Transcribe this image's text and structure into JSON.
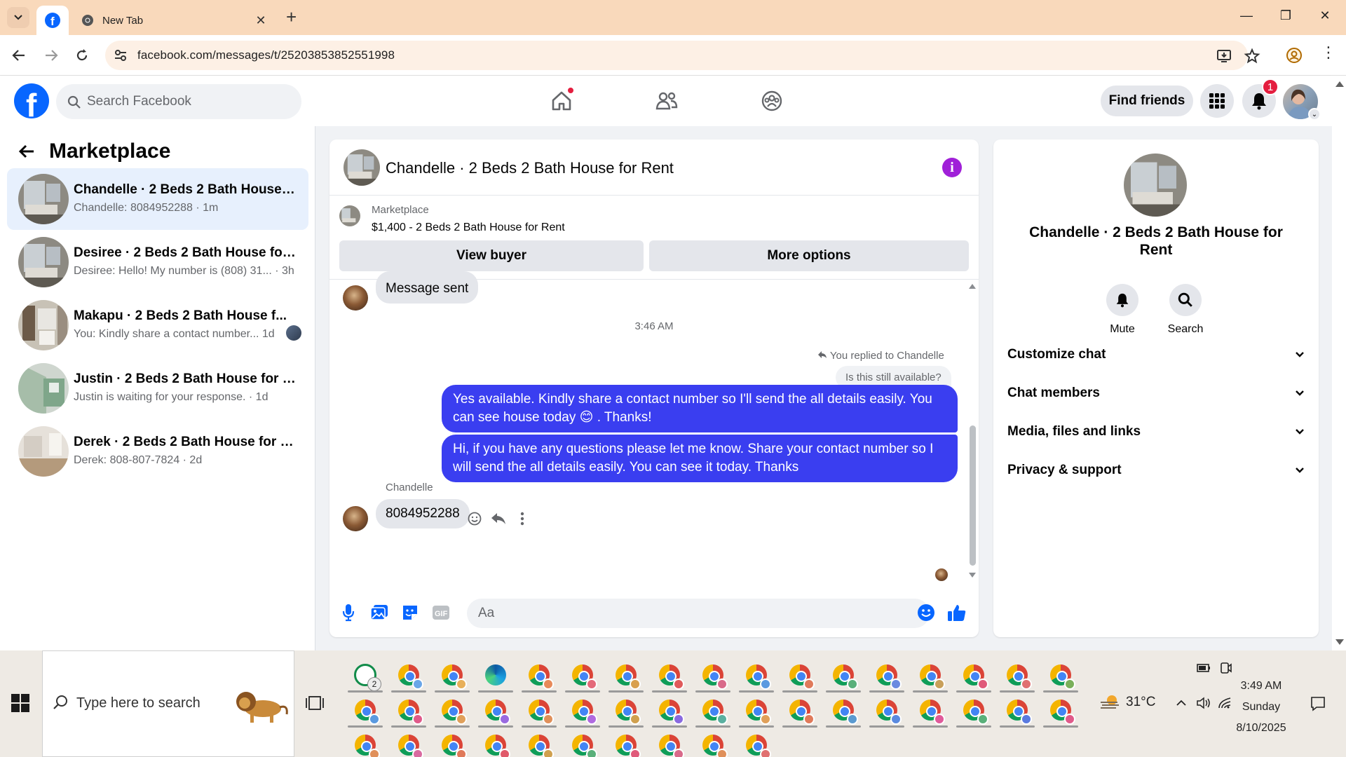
{
  "browser": {
    "tabs": [
      {
        "title": "",
        "icon": "facebook-icon",
        "active": true
      },
      {
        "title": "New Tab",
        "icon": "chrome-icon",
        "active": false
      }
    ],
    "url": "facebook.com/messages/t/25203853852551998"
  },
  "fb_header": {
    "logo_letter": "f",
    "search_placeholder": "Search Facebook",
    "find_friends_label": "Find friends",
    "notification_count": "1"
  },
  "sidebar": {
    "title": "Marketplace",
    "conversations": [
      {
        "title": "Chandelle · 2 Beds 2 Bath House f...",
        "preview": "Chandelle: 8084952288 · 1m",
        "active": true
      },
      {
        "title": "Desiree · 2 Beds 2 Bath House for ...",
        "preview": "Desiree: Hello! My number is (808) 31... · 3h",
        "active": false
      },
      {
        "title": "Makapu · 2 Beds 2 Bath House f...",
        "preview": "You: Kindly share a contact number...  1d",
        "active": false
      },
      {
        "title": "Justin · 2 Beds 2 Bath House for R...",
        "preview": "Justin is waiting for your response. · 1d",
        "active": false
      },
      {
        "title": "Derek · 2 Beds 2 Bath House for R...",
        "preview": "Derek: 808-807-7824 · 2d",
        "active": false
      }
    ]
  },
  "chat": {
    "title": "Chandelle · 2 Beds 2 Bath House for Rent",
    "marketplace_label": "Marketplace",
    "listing": "$1,400 - 2 Beds 2 Bath House for Rent",
    "view_buyer_label": "View buyer",
    "more_options_label": "More options",
    "messages": {
      "sent_notice": "Message sent",
      "timestamp": "3:46 AM",
      "reply_note": "You replied to Chandelle",
      "quoted": "Is this still available?",
      "out_1": "Yes available. Kindly share a contact number so I'll send the all details easily. You can see house today 😊 . Thanks!",
      "out_2": "Hi, if you have any questions please let me know. Share your contact number so I will send the all details easily. You can see it today. Thanks",
      "sender": "Chandelle",
      "in_1": "8084952288"
    },
    "composer_placeholder": "Aa"
  },
  "info_panel": {
    "title": "Chandelle · 2 Beds 2 Bath House for Rent",
    "mute_label": "Mute",
    "search_label": "Search",
    "sections": [
      "Customize chat",
      "Chat members",
      "Media, files and links",
      "Privacy & support"
    ]
  },
  "taskbar": {
    "search_placeholder": "Type here to search",
    "whatsapp_count": "2",
    "weather": "31°C",
    "time": "3:49 AM",
    "day": "Sunday",
    "date": "8/10/2025"
  },
  "colors": {
    "fb_blue": "#0866ff",
    "outgoing_bubble": "#3a3ef0",
    "tab_bar": "#f9d9bb",
    "info_purple": "#a020d8",
    "notification_red": "#e41e3f"
  }
}
